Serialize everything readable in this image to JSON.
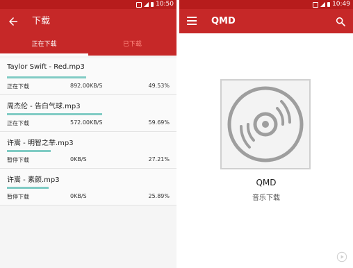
{
  "left_screen": {
    "status_time": "10:50",
    "title": "下载",
    "tabs": [
      {
        "label": "正在下载",
        "active": true
      },
      {
        "label": "已下载",
        "active": false
      }
    ],
    "downloads": [
      {
        "title": "Taylor Swift - Red.mp3",
        "status": "正在下载",
        "speed": "892.00KB/S",
        "percent": "49.53%",
        "progress": 0.4953
      },
      {
        "title": "周杰伦 - 告白气球.mp3",
        "status": "正在下载",
        "speed": "572.00KB/S",
        "percent": "59.69%",
        "progress": 0.5969
      },
      {
        "title": "许嵩 - 明智之举.mp3",
        "status": "暂停下载",
        "speed": "0KB/S",
        "percent": "27.21%",
        "progress": 0.2721
      },
      {
        "title": "许嵩 - 素颜.mp3",
        "status": "暂停下载",
        "speed": "0KB/S",
        "percent": "25.89%",
        "progress": 0.2589
      }
    ]
  },
  "right_screen": {
    "status_time": "10:49",
    "title": "QMD",
    "app_name": "QMD",
    "app_subtitle": "音乐下载"
  },
  "colors": {
    "appbar": "#c62828",
    "statusbar": "#b71c1c",
    "progress": "#80cbc4",
    "inactive_tab": "#ff8a80"
  },
  "icons": [
    "back-arrow-icon",
    "menu-icon",
    "search-icon",
    "disc-icon",
    "play-icon"
  ]
}
